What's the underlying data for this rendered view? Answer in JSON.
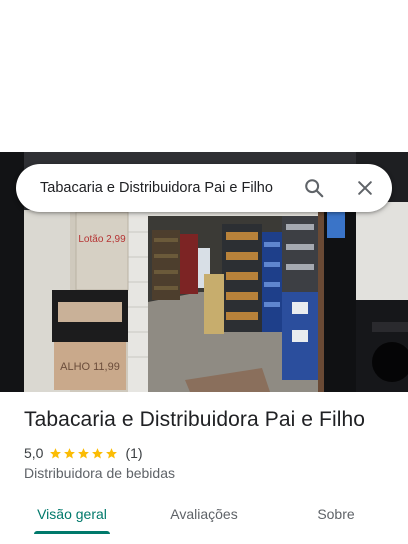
{
  "search": {
    "query": "Tabacaria e Distribuidora Pai e Filho",
    "search_icon": "search-icon",
    "close_icon": "close-icon"
  },
  "photo": {
    "sign_board_text": "Lotão 2,99",
    "cardboard_sign_text": "ALHO 11,99"
  },
  "place": {
    "title": "Tabacaria e Distribuidora Pai e Filho",
    "rating_value": "5,0",
    "star_count": 5,
    "rating_count": "(1)",
    "category": "Distribuidora de bebidas"
  },
  "tabs": [
    {
      "label": "Visão geral",
      "active": true
    },
    {
      "label": "Avaliações",
      "active": false
    },
    {
      "label": "Sobre",
      "active": false
    }
  ],
  "colors": {
    "accent": "#00796b",
    "star": "#fbbc04"
  }
}
